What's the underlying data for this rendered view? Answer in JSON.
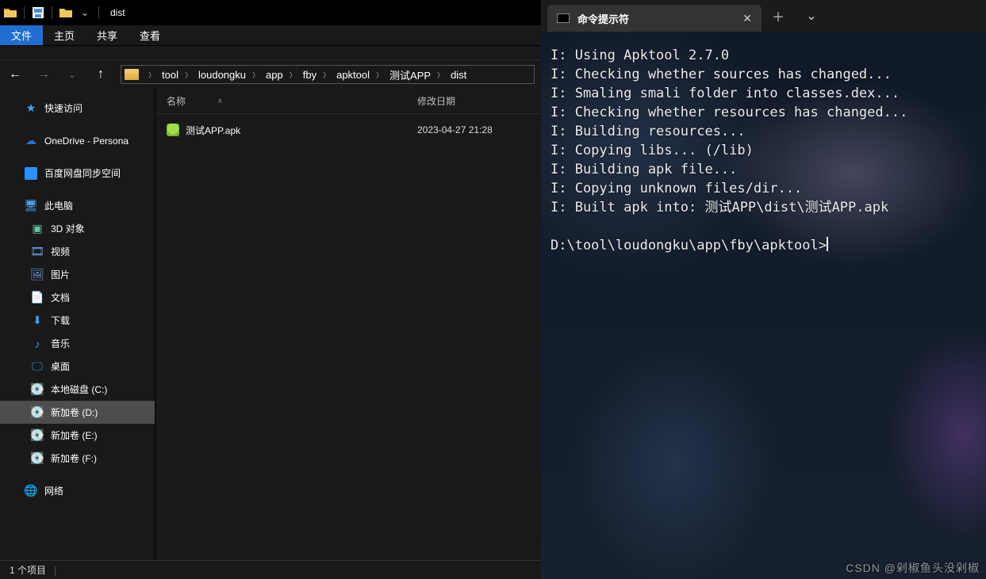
{
  "explorer": {
    "title": "dist",
    "ribbon": {
      "file": "文件",
      "home": "主页",
      "share": "共享",
      "view": "查看"
    },
    "breadcrumb": [
      "tool",
      "loudongku",
      "app",
      "fby",
      "apktool",
      "测试APP",
      "dist"
    ],
    "sidebar": {
      "quick_access": "快速访问",
      "onedrive": "OneDrive - Persona",
      "baidu": "百度网盘同步空间",
      "this_pc": "此电脑",
      "objects3d": "3D 对象",
      "videos": "视频",
      "pictures": "图片",
      "documents": "文档",
      "downloads": "下载",
      "music": "音乐",
      "desktop": "桌面",
      "disk_c": "本地磁盘 (C:)",
      "disk_d": "新加卷 (D:)",
      "disk_e": "新加卷 (E:)",
      "disk_f": "新加卷 (F:)",
      "network": "网络"
    },
    "columns": {
      "name": "名称",
      "date": "修改日期"
    },
    "files": [
      {
        "name": "测试APP.apk",
        "date": "2023-04-27 21:28"
      }
    ],
    "status": "1 个项目"
  },
  "terminal": {
    "tab_title": "命令提示符",
    "lines": [
      "I: Using Apktool 2.7.0",
      "I: Checking whether sources has changed...",
      "I: Smaling smali folder into classes.dex...",
      "I: Checking whether resources has changed...",
      "I: Building resources...",
      "I: Copying libs... (/lib)",
      "I: Building apk file...",
      "I: Copying unknown files/dir...",
      "I: Built apk into: 测试APP\\dist\\测试APP.apk",
      "",
      "D:\\tool\\loudongku\\app\\fby\\apktool>"
    ]
  },
  "watermark": "CSDN @剁椒鱼头没剁椒"
}
